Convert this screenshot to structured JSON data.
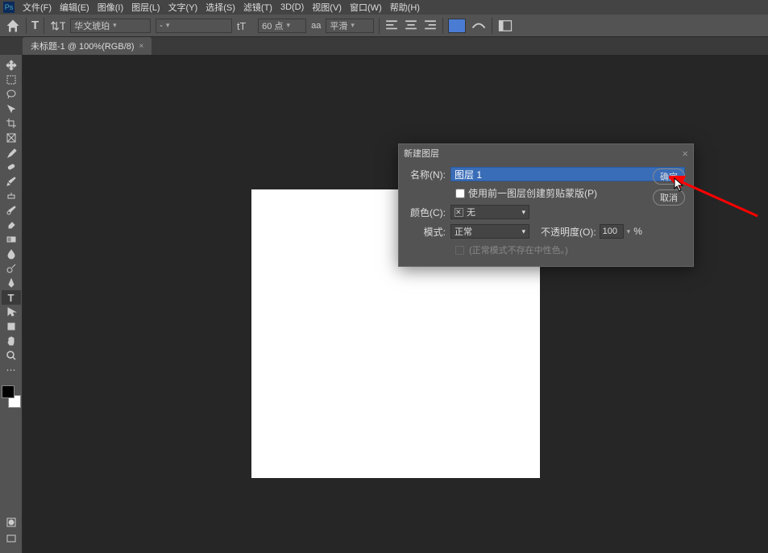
{
  "menu": {
    "items": [
      "文件(F)",
      "编辑(E)",
      "图像(I)",
      "图层(L)",
      "文字(Y)",
      "选择(S)",
      "滤镜(T)",
      "3D(D)",
      "视图(V)",
      "窗口(W)",
      "帮助(H)"
    ]
  },
  "optbar": {
    "font_family": "华文琥珀",
    "font_style": "-",
    "font_size": "60 点",
    "aa_label": "aa",
    "aa_value": "平滑"
  },
  "tab": {
    "title": "未标题-1 @ 100%(RGB/8)"
  },
  "dialog": {
    "title": "新建图层",
    "name_label": "名称(N):",
    "name_value": "图层 1",
    "clip_label": "使用前一图层创建剪贴蒙版(P)",
    "color_label": "颜色(C):",
    "color_value": "无",
    "mode_label": "模式:",
    "mode_value": "正常",
    "opacity_label": "不透明度(O):",
    "opacity_value": "100",
    "opacity_unit": "%",
    "neutral_label": "(正常模式不存在中性色。)",
    "ok": "确定",
    "cancel": "取消"
  }
}
